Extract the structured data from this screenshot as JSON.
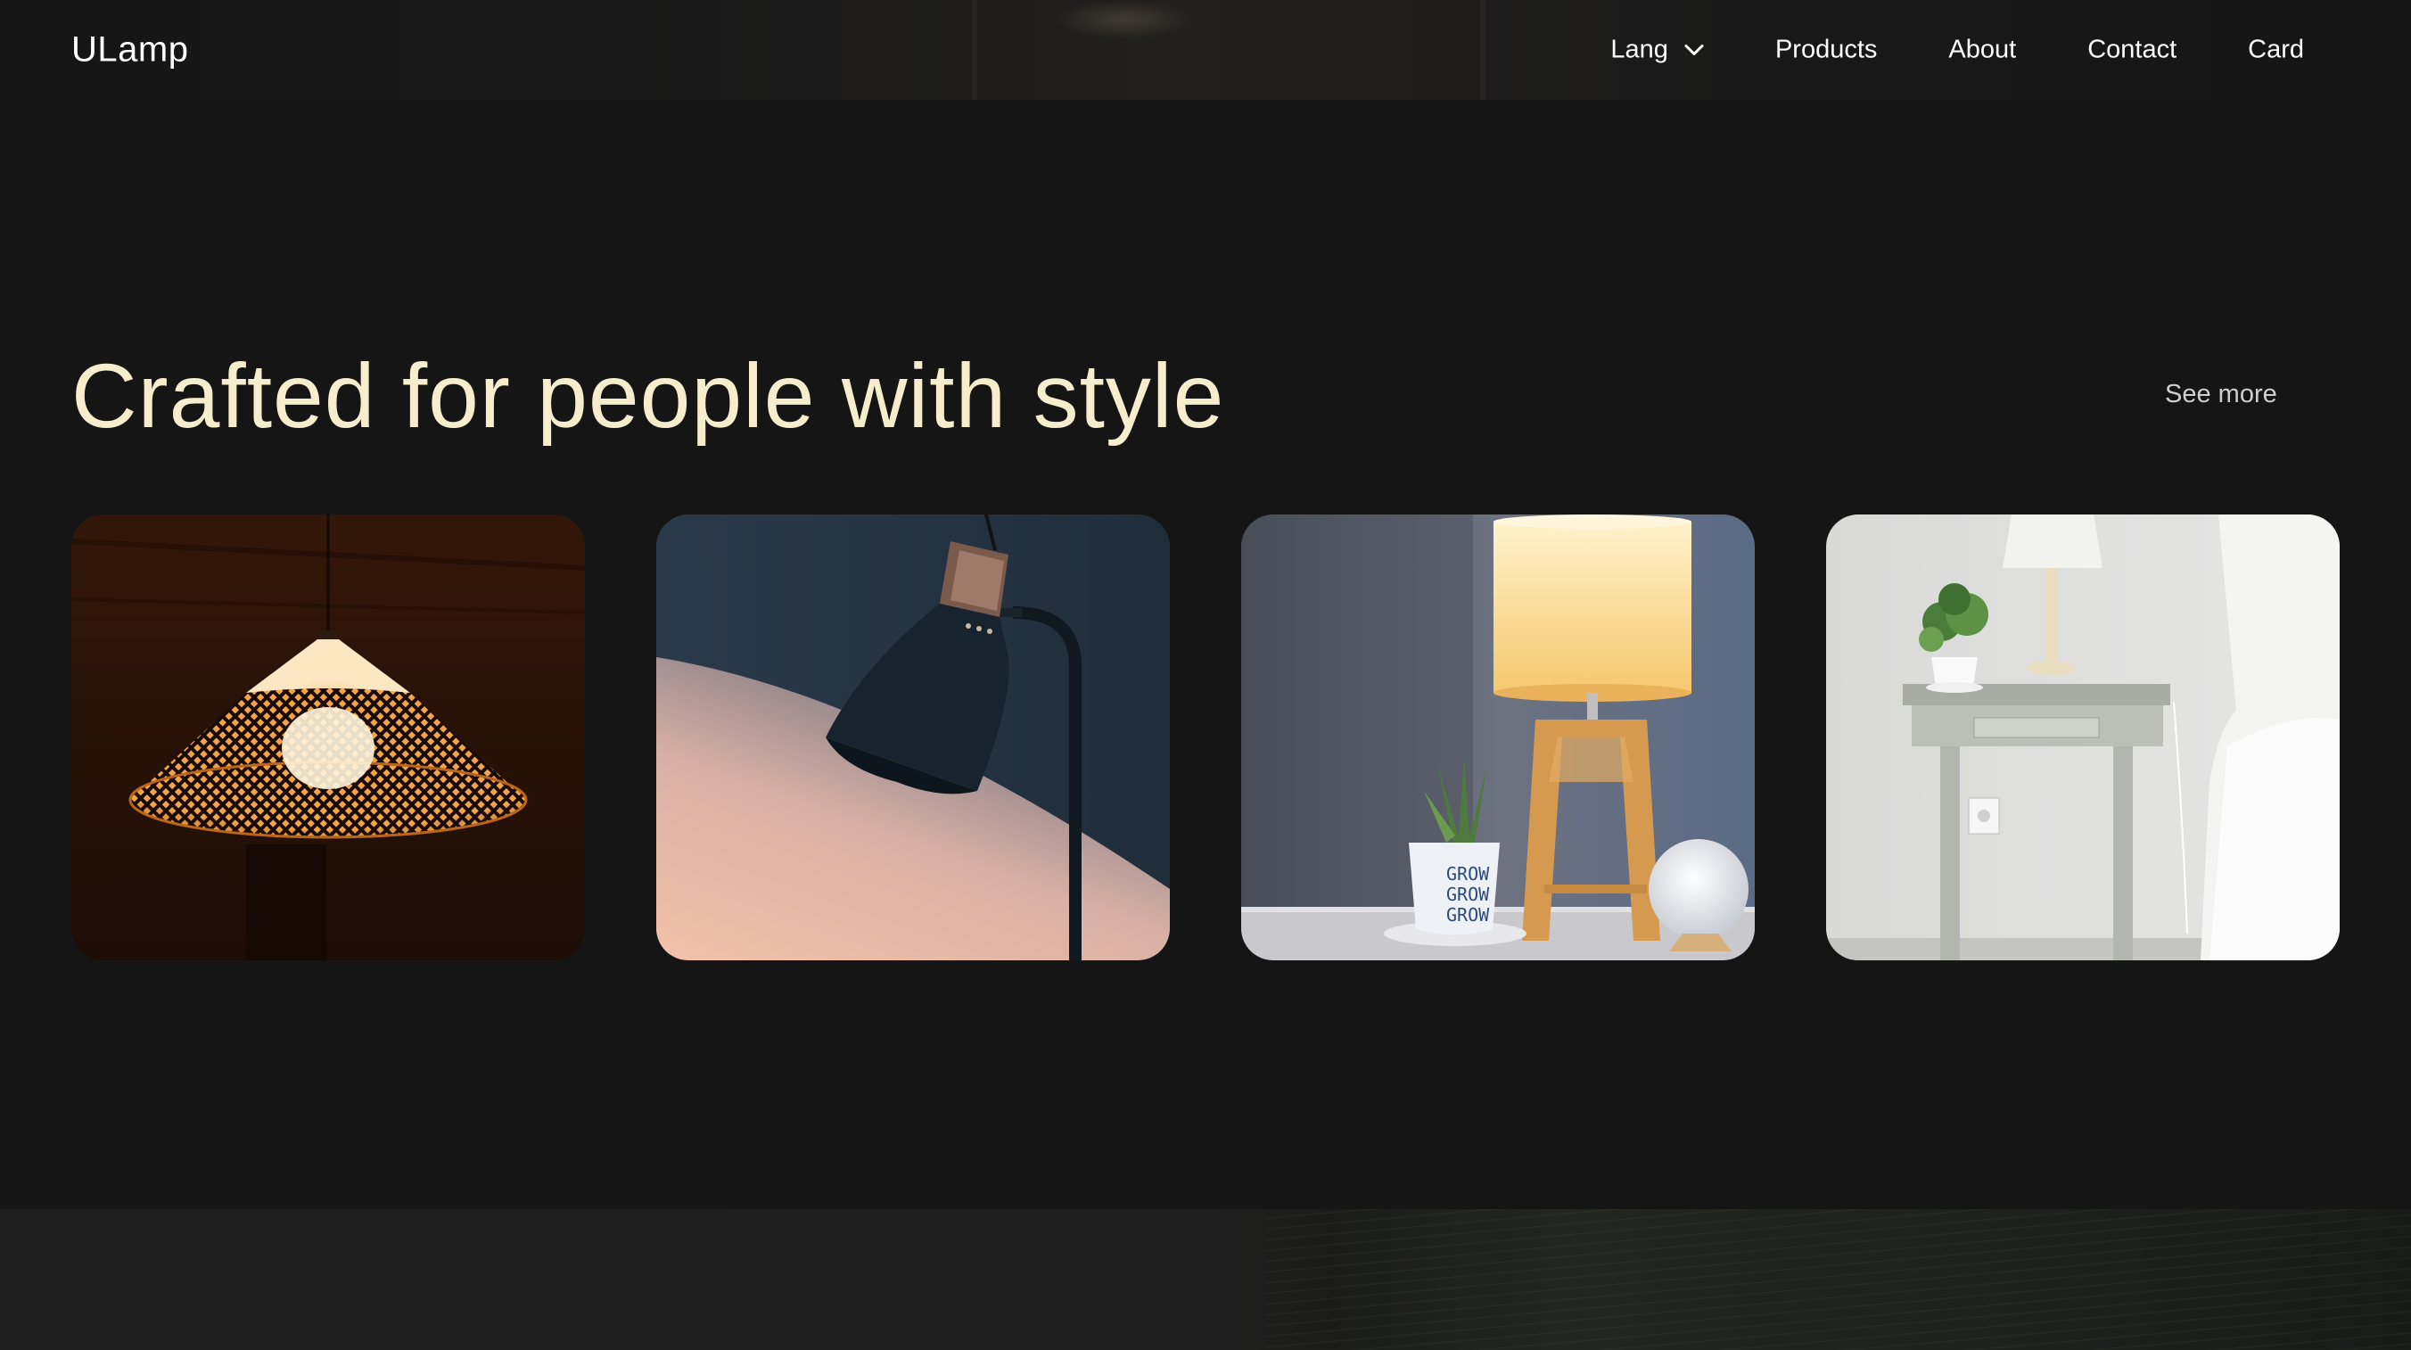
{
  "header": {
    "logo": "ULamp",
    "nav": {
      "lang": "Lang",
      "products": "Products",
      "about": "About",
      "contact": "Contact",
      "card": "Card"
    }
  },
  "hero": {
    "title": "Crafted for people with style",
    "see_more": "See more"
  },
  "products": [
    {
      "image": "pendant-lamp-woven-shade"
    },
    {
      "image": "black-desk-lamp"
    },
    {
      "image": "wooden-table-lamp-with-plant"
    },
    {
      "image": "white-lamp-on-grey-nightstand"
    }
  ],
  "icons": {
    "lang_dropdown": "chevron-down-icon"
  },
  "colors": {
    "background": "#151515",
    "title": "#f6edcc",
    "nav_text": "#ffffff",
    "see_more": "#cfcfcf"
  }
}
